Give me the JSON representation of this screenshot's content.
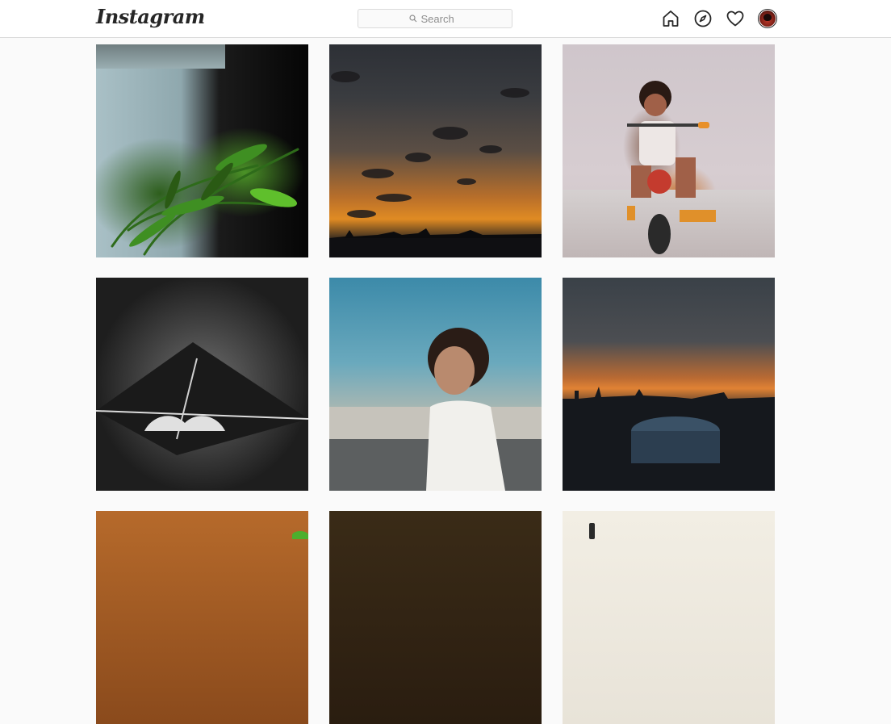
{
  "header": {
    "logo_text": "Instagram",
    "search": {
      "placeholder": "Search",
      "value": ""
    },
    "nav_icons": [
      "home-icon",
      "explore-compass-icon",
      "activity-heart-icon",
      "profile-avatar"
    ]
  },
  "posts": [
    {
      "subject": "plant-wall"
    },
    {
      "subject": "dusk-sky"
    },
    {
      "subject": "child-tricycle"
    },
    {
      "subject": "kite-floor"
    },
    {
      "subject": "boy-blue-sky"
    },
    {
      "subject": "orange-horizon-city"
    },
    {
      "subject": "warm-orange"
    },
    {
      "subject": "dark-brown"
    },
    {
      "subject": "pale-sky"
    }
  ],
  "colors": {
    "header_bg": "#ffffff",
    "page_bg": "#fafafa",
    "border": "#dbdbdb",
    "text": "#262626",
    "muted": "#8e8e8e"
  }
}
